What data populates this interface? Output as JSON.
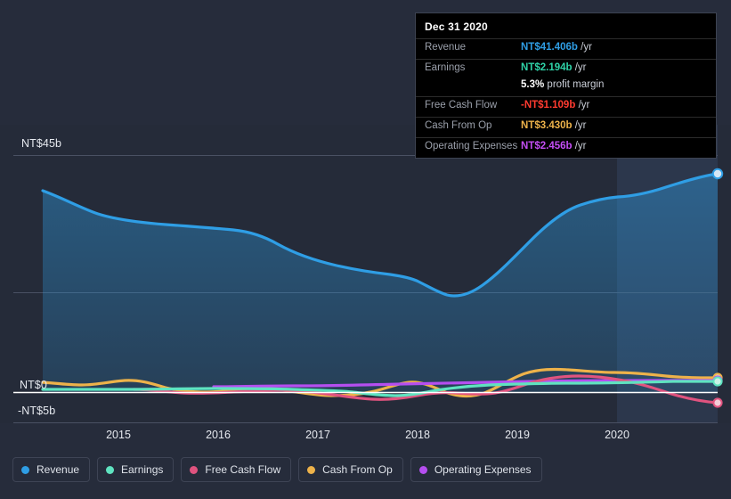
{
  "colors": {
    "background": "#262c3b",
    "plot_background": "#252b39",
    "highlight_band": "#2b3850",
    "zero_line": "#ffffff",
    "gridline": "#4a5163",
    "revenue": "#2f9ee5",
    "earnings": "#5fe3c0",
    "free_cash_flow": "#e0537f",
    "cash_from_op": "#edb24a",
    "operating_expenses": "#b54ef0",
    "tooltip_bg": "#000000",
    "tooltip_border": "#3d4352",
    "negative_value": "#ff3b30"
  },
  "tooltip": {
    "title": "Dec 31 2020",
    "rows": [
      {
        "label": "Revenue",
        "value": "NT$41.406b",
        "unit": "/yr",
        "color": "#2f9ee5"
      },
      {
        "label": "Earnings",
        "value": "NT$2.194b",
        "unit": "/yr",
        "color": "#2fd3a8"
      },
      {
        "label": "Free Cash Flow",
        "value": "-NT$1.109b",
        "unit": "/yr",
        "color": "#ff3b30"
      },
      {
        "label": "Cash From Op",
        "value": "NT$3.430b",
        "unit": "/yr",
        "color": "#edb24a"
      },
      {
        "label": "Operating Expenses",
        "value": "NT$2.456b",
        "unit": "/yr",
        "color": "#c44ef5"
      }
    ],
    "profit_margin_value": "5.3%",
    "profit_margin_label": "profit margin"
  },
  "legend": {
    "items": [
      {
        "label": "Revenue",
        "color": "#2f9ee5"
      },
      {
        "label": "Earnings",
        "color": "#5fe3c0"
      },
      {
        "label": "Free Cash Flow",
        "color": "#e0537f"
      },
      {
        "label": "Cash From Op",
        "color": "#edb24a"
      },
      {
        "label": "Operating Expenses",
        "color": "#b54ef0"
      }
    ]
  },
  "axes": {
    "y_labels": [
      "NT$45b",
      "NT$0",
      "-NT$5b"
    ],
    "x_labels": [
      "2015",
      "2016",
      "2017",
      "2018",
      "2019",
      "2020"
    ]
  },
  "chart_data": {
    "type": "area",
    "title": "",
    "xlabel": "",
    "ylabel": "NT$ billions per year",
    "ylim": [
      -5,
      45
    ],
    "grid": true,
    "legend_position": "bottom",
    "x_tick_labels": [
      "2015",
      "2016",
      "2017",
      "2018",
      "2019",
      "2020"
    ],
    "x": [
      2014.3,
      2014.6,
      2015.0,
      2015.3,
      2015.6,
      2016.0,
      2016.3,
      2016.6,
      2017.0,
      2017.3,
      2017.6,
      2018.0,
      2018.3,
      2018.6,
      2019.0,
      2019.3,
      2019.6,
      2020.0,
      2020.3,
      2020.6,
      2021.0
    ],
    "series": [
      {
        "name": "Revenue",
        "color": "#2f9ee5",
        "values": [
          38.0,
          35.5,
          34.3,
          34.0,
          33.6,
          32.6,
          31.0,
          29.6,
          28.8,
          28.7,
          28.4,
          27.5,
          25.2,
          24.3,
          24.5,
          26.6,
          30.8,
          34.1,
          34.2,
          35.6,
          41.4
        ]
      },
      {
        "name": "Earnings",
        "color": "#5fe3c0",
        "values": [
          0.2,
          0.2,
          0.2,
          0.2,
          0.2,
          0.1,
          0.0,
          0.1,
          0.2,
          0.3,
          0.3,
          0.2,
          -0.2,
          -0.3,
          0.1,
          0.5,
          0.7,
          0.9,
          1.2,
          1.6,
          2.194
        ]
      },
      {
        "name": "Free Cash Flow",
        "color": "#e0537f",
        "values": [
          0.0,
          0.0,
          0.0,
          -0.2,
          -0.4,
          -0.6,
          -0.6,
          -0.6,
          -0.5,
          -0.5,
          -0.4,
          -0.8,
          -1.2,
          -1.3,
          -0.9,
          0.3,
          1.3,
          1.7,
          1.4,
          0.6,
          -1.109
        ]
      },
      {
        "name": "Cash From Op",
        "color": "#edb24a",
        "values": [
          1.8,
          1.5,
          1.6,
          1.9,
          1.4,
          0.3,
          0.0,
          0.1,
          0.3,
          0.6,
          0.3,
          -0.2,
          -0.5,
          -0.6,
          0.1,
          1.4,
          2.5,
          2.8,
          2.6,
          2.5,
          3.43
        ]
      },
      {
        "name": "Operating Expenses",
        "color": "#b54ef0",
        "values": [
          null,
          null,
          null,
          null,
          0.9,
          0.9,
          0.9,
          0.9,
          1.0,
          1.1,
          1.1,
          1.2,
          1.2,
          1.2,
          1.2,
          1.3,
          1.4,
          1.5,
          1.6,
          1.8,
          2.456
        ]
      }
    ],
    "annotations": [
      {
        "type": "forecast-band",
        "start_x": 2020.05,
        "end_x": 2021.0
      },
      {
        "type": "endpoint-markers",
        "x": 2021.0
      }
    ]
  }
}
